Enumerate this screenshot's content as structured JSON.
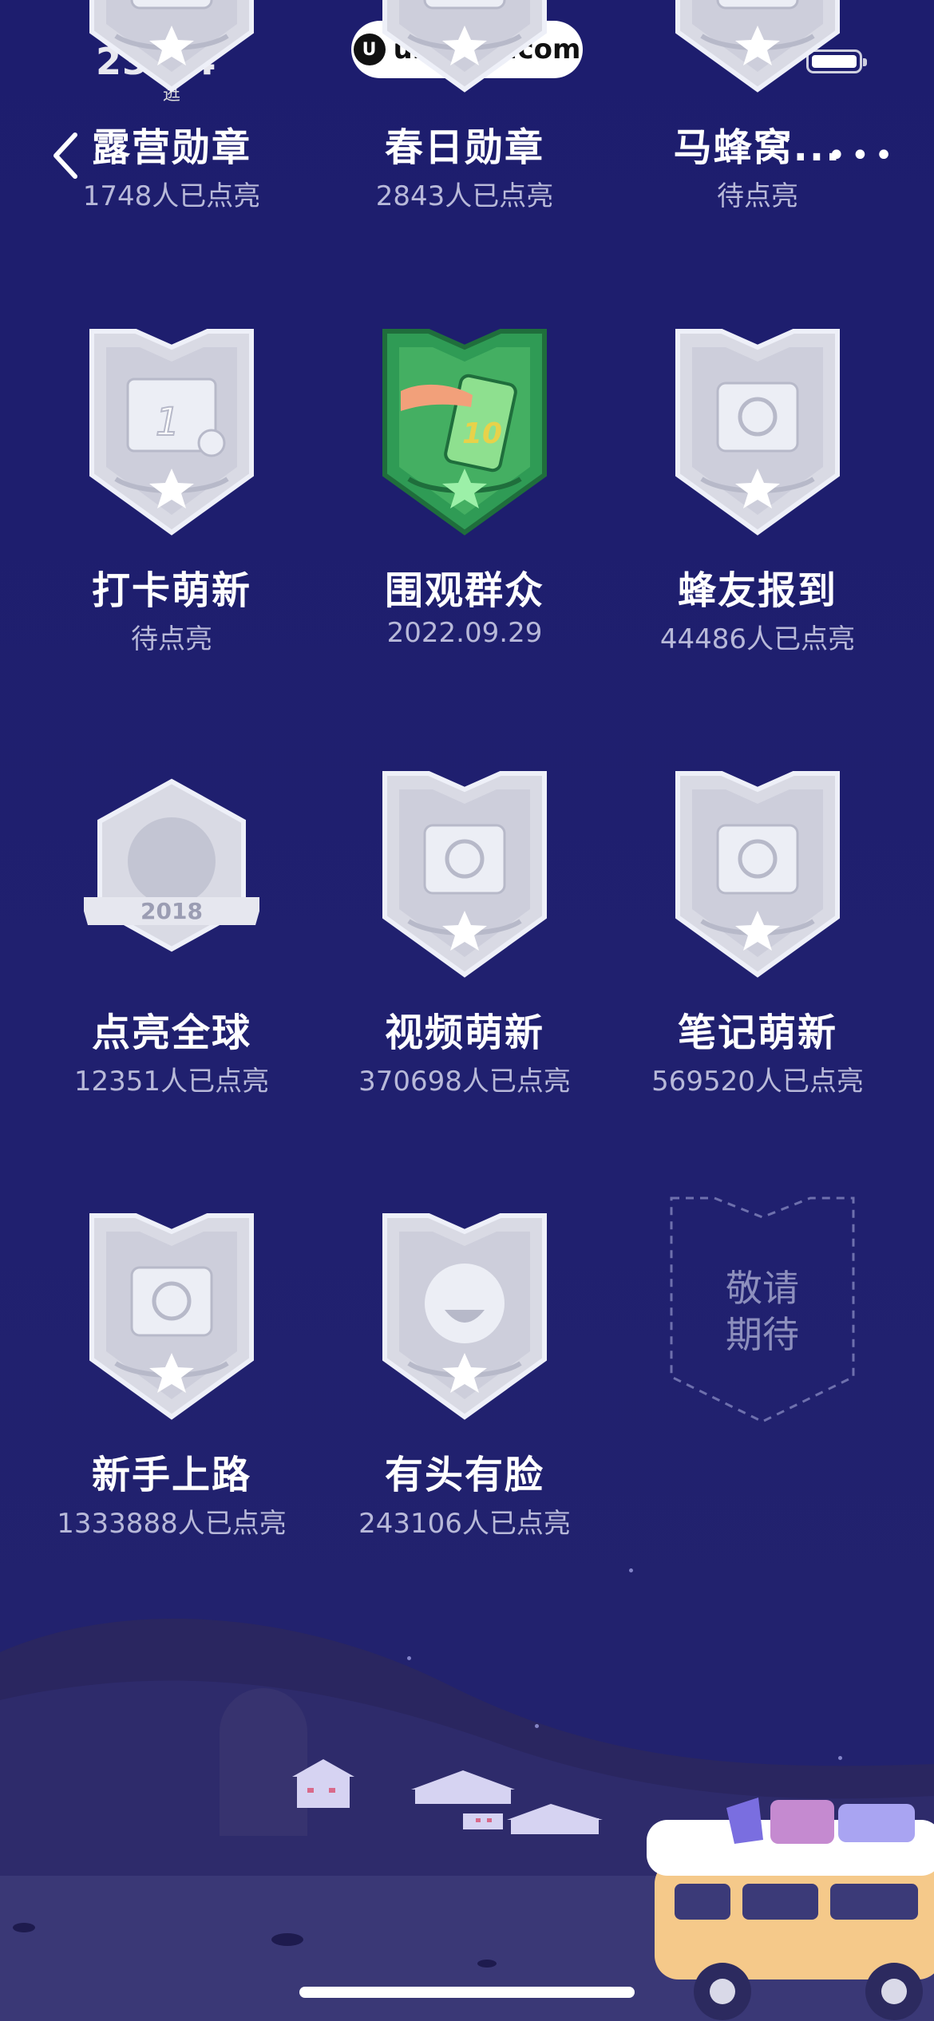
{
  "status_bar": {
    "time": "23:24",
    "sub": "逛"
  },
  "watermark": {
    "logo": "U",
    "text": "uinotes.com"
  },
  "nav": {
    "back_icon": "chevron-left-icon",
    "more_icon": "more-dots-icon",
    "more_label": "•••"
  },
  "badges": [
    {
      "name": "露营勋章",
      "sub": "1748人已点亮",
      "icon": "camping-badge-icon",
      "lit": false
    },
    {
      "name": "春日勋章",
      "sub": "2843人已点亮",
      "icon": "spring-badge-icon",
      "lit": false
    },
    {
      "name": "马蜂窝...",
      "sub": "待点亮",
      "icon": "mafengwo-badge-icon",
      "lit": false
    },
    {
      "name": "打卡萌新",
      "sub": "待点亮",
      "icon": "checkin-calendar-badge-icon",
      "lit": false
    },
    {
      "name": "围观群众",
      "sub": "2022.09.29",
      "icon": "phone-10-badge-icon",
      "lit": true
    },
    {
      "name": "蜂友报到",
      "sub": "44486人已点亮",
      "icon": "friend-checkin-badge-icon",
      "lit": false
    },
    {
      "name": "点亮全球",
      "sub": "12351人已点亮",
      "icon": "globe-2018-badge-icon",
      "lit": false
    },
    {
      "name": "视频萌新",
      "sub": "370698人已点亮",
      "icon": "video-badge-icon",
      "lit": false
    },
    {
      "name": "笔记萌新",
      "sub": "569520人已点亮",
      "icon": "notes-badge-icon",
      "lit": false
    },
    {
      "name": "新手上路",
      "sub": "1333888人已点亮",
      "icon": "newbie-shoe-badge-icon",
      "lit": false
    },
    {
      "name": "有头有脸",
      "sub": "243106人已点亮",
      "icon": "face-badge-icon",
      "lit": false
    }
  ],
  "badge_labels": {
    "year": "2018",
    "ten": "10",
    "one": "1"
  },
  "coming_soon": {
    "line1": "敬请",
    "line2": "期待"
  },
  "colors": {
    "background": "#1f1f6e",
    "silver": "#d9dae4",
    "green": "#2f9b55",
    "subtext": "#b8b9d9"
  }
}
